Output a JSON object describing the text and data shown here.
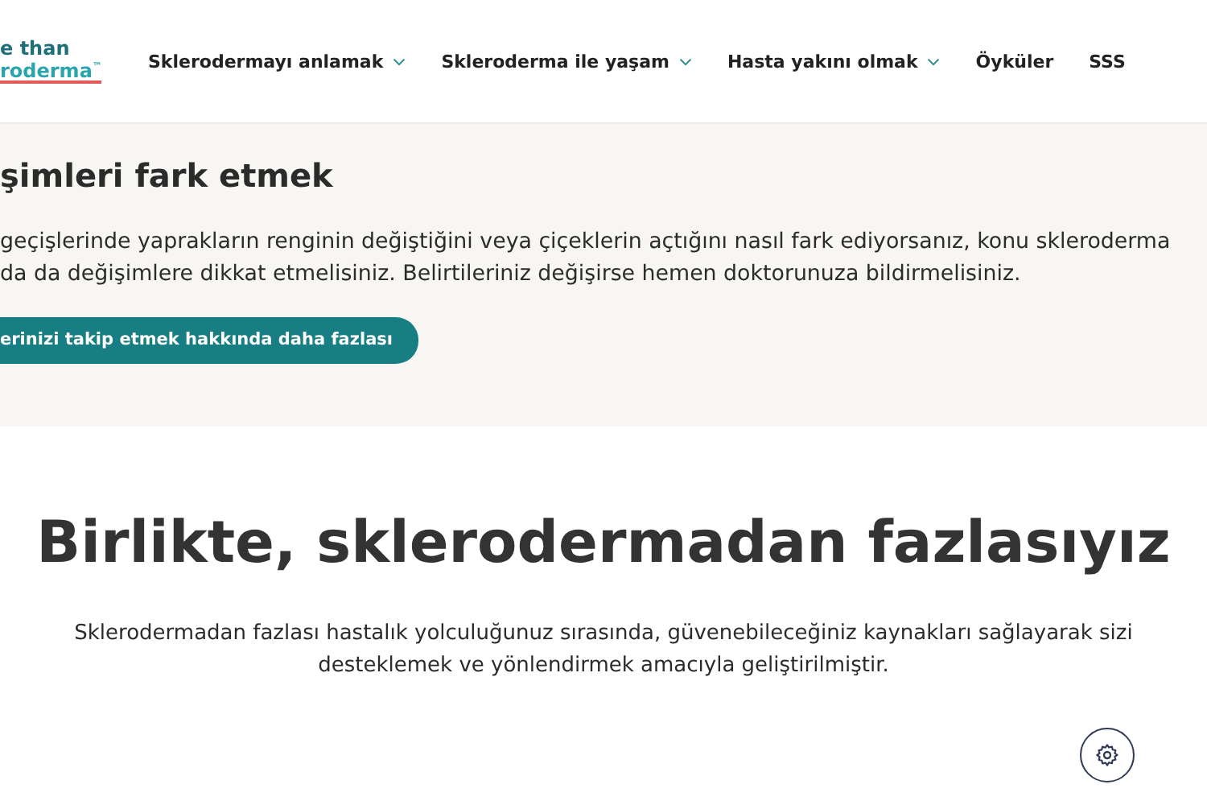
{
  "logo": {
    "lines": [
      "e than",
      "roderma"
    ],
    "mark": "™"
  },
  "nav": [
    {
      "label": "Sklerodermayı anlamak",
      "has_menu": true
    },
    {
      "label": "Skleroderma ile yaşam",
      "has_menu": true
    },
    {
      "label": "Hasta yakını olmak",
      "has_menu": true
    },
    {
      "label": "Öyküler",
      "has_menu": false
    },
    {
      "label": "SSS",
      "has_menu": false
    }
  ],
  "feature": {
    "heading": "şimleri fark etmek",
    "paragraph_lines": [
      "geçişlerinde yaprakların renginin değiştiğini veya çiçeklerin açtığını nasıl fark ediyorsanız, konu skleroderma",
      "da da değişimlere dikkat etmelisiniz. Belirtileriniz değişirse hemen doktorunuza bildirmelisiniz."
    ],
    "button": "erinizi takip etmek hakkında daha fazlası"
  },
  "intro": {
    "heading": "Birlikte, sklerodermadan fazlasıyız",
    "paragraph_lines": [
      "Sklerodermadan fazlası hastalık yolculuğunuz sırasında, güvenebileceğiniz kaynakları sağlayarak sizi",
      "desteklemek ve yönlendirmek amacıyla geliştirilmiştir."
    ]
  }
}
